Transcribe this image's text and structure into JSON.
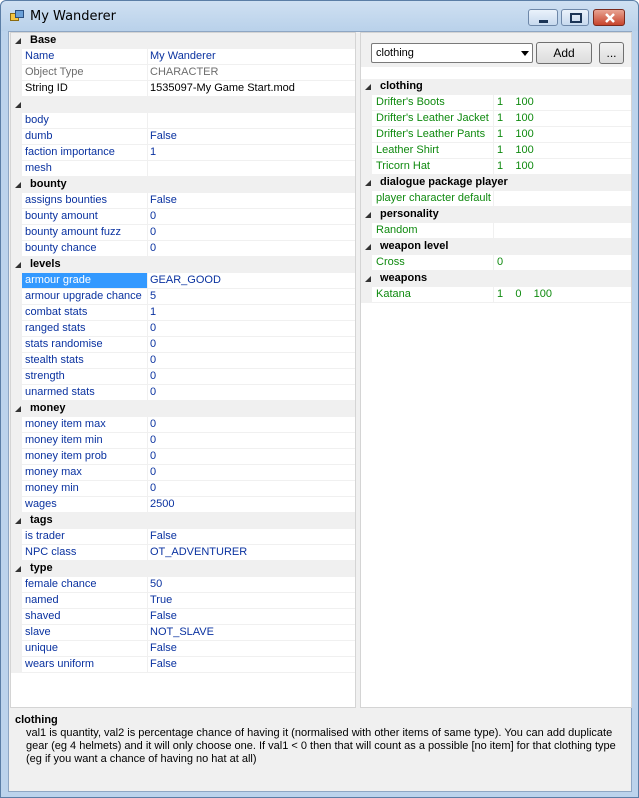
{
  "window": {
    "title": "My Wanderer",
    "icon": "app-window-icon"
  },
  "grid": {
    "categories": {
      "base": "Base",
      "unnamed": "",
      "bounty": "bounty",
      "levels": "levels",
      "money": "money",
      "tags": "tags",
      "type": "type"
    },
    "base": [
      {
        "name": "Name",
        "value": "My Wanderer"
      },
      {
        "name": "Object Type",
        "value": "CHARACTER"
      },
      {
        "name": "String ID",
        "value": "1535097-My Game Start.mod"
      }
    ],
    "unnamed": [
      {
        "name": "body",
        "value": ""
      },
      {
        "name": "dumb",
        "value": "False"
      },
      {
        "name": "faction importance",
        "value": "1"
      },
      {
        "name": "mesh",
        "value": ""
      }
    ],
    "bounty": [
      {
        "name": "assigns bounties",
        "value": "False"
      },
      {
        "name": "bounty amount",
        "value": "0"
      },
      {
        "name": "bounty amount fuzz",
        "value": "0"
      },
      {
        "name": "bounty chance",
        "value": "0"
      }
    ],
    "levels": [
      {
        "name": "armour grade",
        "value": "GEAR_GOOD"
      },
      {
        "name": "armour upgrade chance",
        "value": "5"
      },
      {
        "name": "combat stats",
        "value": "1"
      },
      {
        "name": "ranged stats",
        "value": "0"
      },
      {
        "name": "stats randomise",
        "value": "0"
      },
      {
        "name": "stealth stats",
        "value": "0"
      },
      {
        "name": "strength",
        "value": "0"
      },
      {
        "name": "unarmed stats",
        "value": "0"
      }
    ],
    "money": [
      {
        "name": "money item max",
        "value": "0"
      },
      {
        "name": "money item min",
        "value": "0"
      },
      {
        "name": "money item prob",
        "value": "0"
      },
      {
        "name": "money max",
        "value": "0"
      },
      {
        "name": "money min",
        "value": "0"
      },
      {
        "name": "wages",
        "value": "2500"
      }
    ],
    "tags": [
      {
        "name": "is trader",
        "value": "False"
      },
      {
        "name": "NPC class",
        "value": "OT_ADVENTURER"
      }
    ],
    "type": [
      {
        "name": "female chance",
        "value": "50"
      },
      {
        "name": "named",
        "value": "True"
      },
      {
        "name": "shaved",
        "value": "False"
      },
      {
        "name": "slave",
        "value": "NOT_SLAVE"
      },
      {
        "name": "unique",
        "value": "False"
      },
      {
        "name": "wears uniform",
        "value": "False"
      }
    ]
  },
  "refs": {
    "combo_value": "clothing",
    "add_label": "Add",
    "more_label": "...",
    "categories": {
      "clothing": "clothing",
      "dialogue": "dialogue package player",
      "personality": "personality",
      "weapon_level": "weapon level",
      "weapons": "weapons"
    },
    "clothing": [
      {
        "name": "Drifter's Boots",
        "value": "1    100"
      },
      {
        "name": "Drifter's Leather Jacket",
        "value": "1    100"
      },
      {
        "name": "Drifter's Leather Pants",
        "value": "1    100"
      },
      {
        "name": "Leather Shirt",
        "value": "1    100"
      },
      {
        "name": "Tricorn Hat",
        "value": "1    100"
      }
    ],
    "dialogue": [
      {
        "name": "player character default",
        "value": ""
      }
    ],
    "personality": [
      {
        "name": "Random",
        "value": ""
      }
    ],
    "weapon_level": [
      {
        "name": "Cross",
        "value": "0"
      }
    ],
    "weapons": [
      {
        "name": "Katana",
        "value": "1    0    100"
      }
    ]
  },
  "description": {
    "title": "clothing",
    "text": "val1 is quantity, val2 is percentage chance of having it (normalised with other items of same type).  You can add duplicate gear (eg 4 helmets) and it will only choose one.  If val1 < 0 then that will count as a possible [no item] for that clothing type (eg if you want a chance of having no hat at all)"
  },
  "colors": {
    "selection": "#3399ff",
    "property_text": "#0a32a0",
    "reference_text": "#0f8a0f",
    "readonly_text": "#6d6d6d"
  }
}
